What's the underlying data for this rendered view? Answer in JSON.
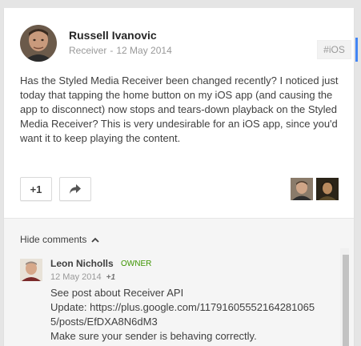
{
  "post": {
    "author": "Russell Ivanovic",
    "source": "Receiver",
    "separator": "-",
    "date": "12 May 2014",
    "tag": "#iOS",
    "body": "Has the Styled Media Receiver been changed recently? I noticed just today that tapping the home button on my iOS app (and causing the app to disconnect) now stops and tears-down playback on the Styled Media Receiver? This is very undesirable for an iOS app, since you'd want it to keep playing the content.",
    "plus_one_label": "+1",
    "share_icon": "share-arrow-icon",
    "plusoners": [
      "plusoner-avatar-1",
      "plusoner-avatar-2"
    ]
  },
  "comments": {
    "toggle_label": "Hide comments",
    "toggle_icon": "chevron-up-icon",
    "items": [
      {
        "author": "Leon Nicholls",
        "badge": "OWNER",
        "date": "12 May 2014",
        "plus_ones": "+1",
        "lines": [
          "See post about Receiver API",
          "Update: https://plus.google.com/11791605552164281065",
          "5/posts/EfDXA8N6dM3",
          "Make sure your sender is behaving correctly."
        ]
      }
    ]
  },
  "colors": {
    "accent": "#4285f4",
    "owner_badge": "#3d9400",
    "background": "#e5e5e5"
  }
}
